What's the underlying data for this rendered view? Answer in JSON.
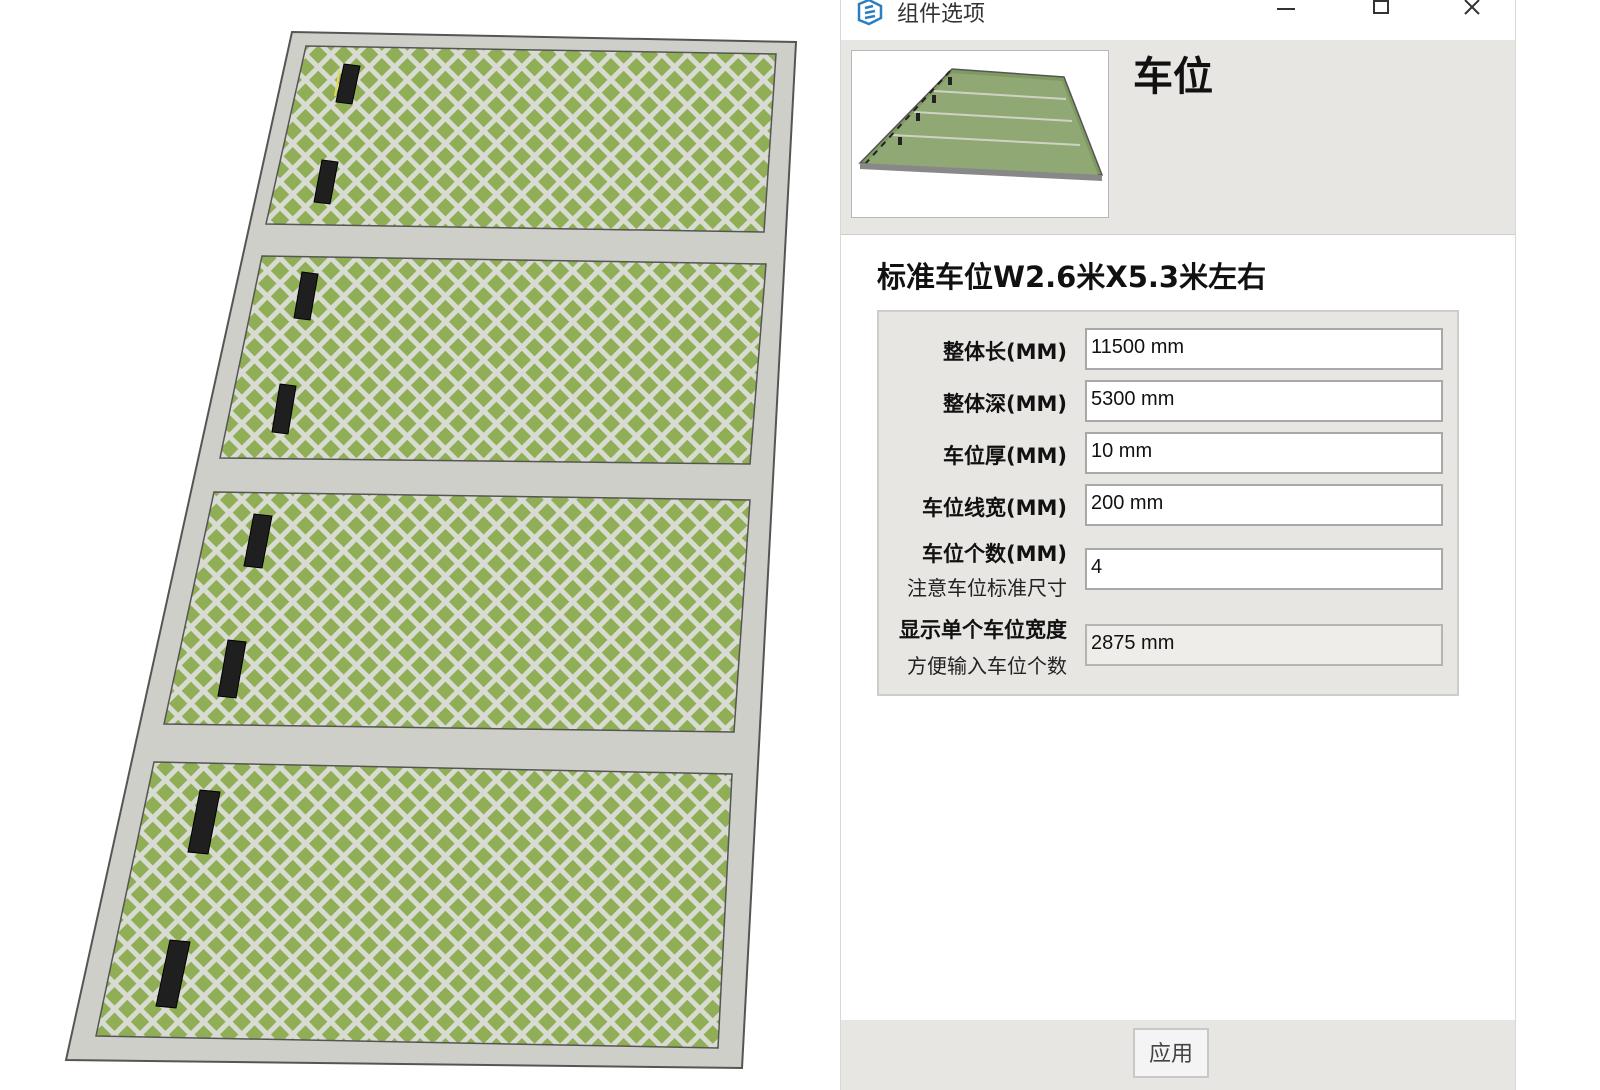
{
  "dialog": {
    "title": "组件选项",
    "component_name": "车位",
    "description": "标准车位W2.6米X5.3米左右",
    "fields": [
      {
        "label": "整体长(MM)",
        "value": "11500 mm",
        "note": ""
      },
      {
        "label": "整体深(MM)",
        "value": "5300 mm",
        "note": ""
      },
      {
        "label": "车位厚(MM)",
        "value": "10 mm",
        "note": ""
      },
      {
        "label": "车位线宽(MM)",
        "value": "200 mm",
        "note": ""
      },
      {
        "label": "车位个数(MM)",
        "value": "4",
        "note": "注意车位标准尺寸"
      },
      {
        "label": "显示单个车位宽度",
        "value": "2875 mm",
        "note": "方便输入车位个数"
      }
    ],
    "apply_label": "应用"
  },
  "icons": {
    "app": "sketchup-logo-icon",
    "minimize": "minimize-icon",
    "maximize": "maximize-icon",
    "close": "close-icon"
  },
  "colors": {
    "grass": "#8fae55",
    "paver": "#d6d9cf",
    "border": "#c9c9c4",
    "panel": "#e8e6e3",
    "accent": "#2a7fc0"
  }
}
